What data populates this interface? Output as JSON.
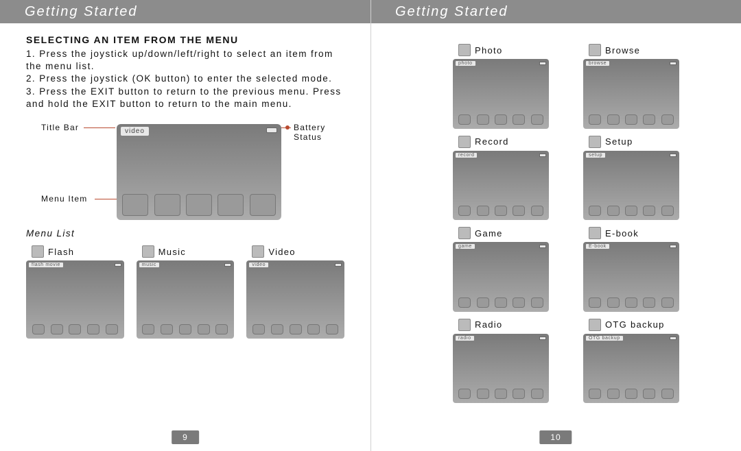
{
  "page_left": {
    "banner": "Getting Started",
    "section_title": "SELECTING AN ITEM FROM THE MENU",
    "steps": [
      "1. Press the joystick up/down/left/right to select an item from the menu list.",
      "2. Press the joystick (OK button) to enter the selected mode.",
      "3. Press the EXIT button to return to the previous menu. Press and hold the EXIT button to return to the main menu."
    ],
    "diagram": {
      "label_titlebar": "Title Bar",
      "label_battery": "Battery Status",
      "label_menuitem": "Menu Item",
      "screen_title": "video"
    },
    "menu_list_heading": "Menu List",
    "bottom_items": [
      {
        "label": "Flash",
        "screen_title": "flash movie"
      },
      {
        "label": "Music",
        "screen_title": "music"
      },
      {
        "label": "Video",
        "screen_title": "video"
      }
    ],
    "page_number": "9"
  },
  "page_right": {
    "banner": "Getting Started",
    "items": [
      {
        "label": "Photo",
        "screen_title": "photo"
      },
      {
        "label": "Browse",
        "screen_title": "browse"
      },
      {
        "label": "Record",
        "screen_title": "record"
      },
      {
        "label": "Setup",
        "screen_title": "setup"
      },
      {
        "label": "Game",
        "screen_title": "game"
      },
      {
        "label": "E-book",
        "screen_title": "E-book"
      },
      {
        "label": "Radio",
        "screen_title": "radio"
      },
      {
        "label": "OTG backup",
        "screen_title": "OTG backup"
      }
    ],
    "page_number": "10"
  }
}
